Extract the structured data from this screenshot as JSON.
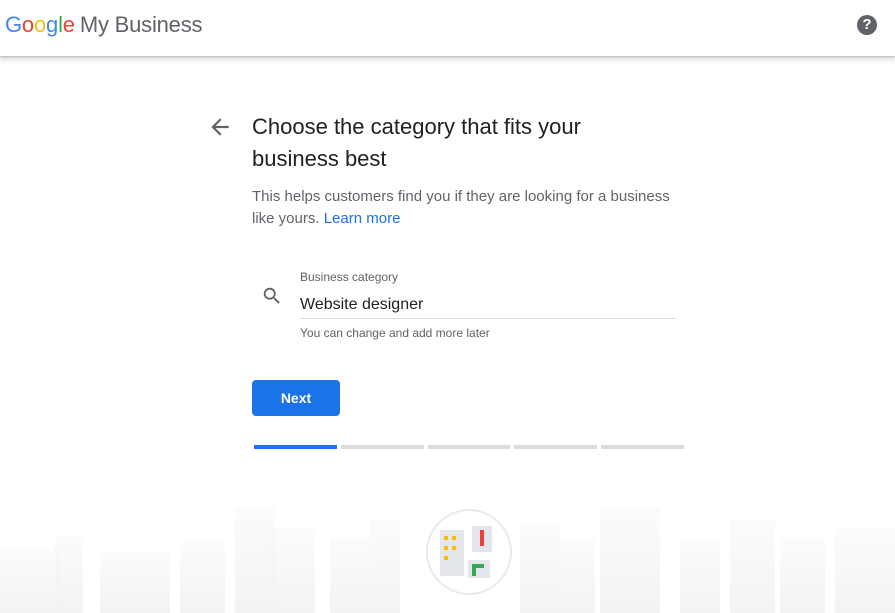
{
  "header": {
    "logo_letters": [
      "G",
      "o",
      "o",
      "g",
      "l",
      "e"
    ],
    "logo_colors": [
      "#4285F4",
      "#EA4335",
      "#FBBC05",
      "#4285F4",
      "#34A853",
      "#EA4335"
    ],
    "product_name": "My Business",
    "help_icon": "help-circle-icon",
    "help_glyph": "?"
  },
  "main": {
    "back_icon": "arrow-back-icon",
    "title": "Choose the category that fits your business best",
    "subtitle": "This helps customers find you if they are looking for a business like yours.",
    "learn_more": "Learn more",
    "search_icon": "search-icon",
    "field_label": "Business category",
    "field_value": "Website designer",
    "field_helper": "You can change and add more later",
    "next_label": "Next"
  },
  "progress": {
    "total_steps": 5,
    "current_step": 1
  },
  "colors": {
    "accent": "#1a73e8",
    "text_primary": "#202124",
    "text_secondary": "#5f6368",
    "divider": "#dadce0"
  }
}
